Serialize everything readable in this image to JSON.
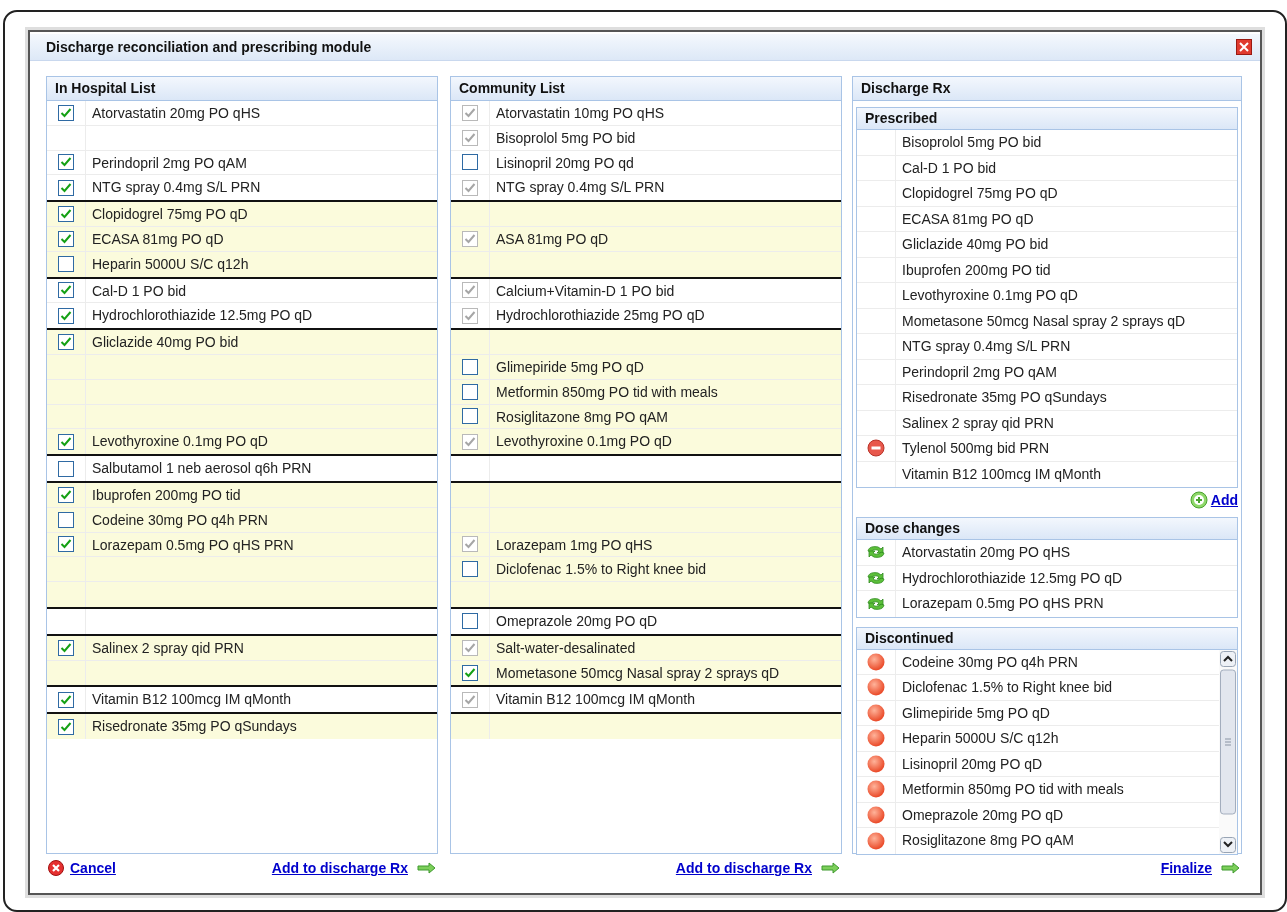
{
  "window": {
    "title": "Discharge reconciliation and prescribing module"
  },
  "in_hospital_list": {
    "title": "In Hospital List",
    "cancel_link": "Cancel",
    "footer_link": "Add to discharge Rx",
    "groups": [
      {
        "highlighted": false,
        "rows": [
          {
            "kind": "item",
            "label": "Atorvastatin 20mg PO qHS",
            "checked": true,
            "disabled": false
          },
          {
            "kind": "blank"
          },
          {
            "kind": "item",
            "label": "Perindopril 2mg PO qAM",
            "checked": true,
            "disabled": false
          },
          {
            "kind": "item",
            "label": "NTG spray 0.4mg S/L PRN",
            "checked": true,
            "disabled": false
          }
        ]
      },
      {
        "highlighted": true,
        "rows": [
          {
            "kind": "item",
            "label": "Clopidogrel 75mg PO qD",
            "checked": true,
            "disabled": false
          },
          {
            "kind": "item",
            "label": "ECASA 81mg PO qD",
            "checked": true,
            "disabled": false
          },
          {
            "kind": "item",
            "label": "Heparin 5000U S/C q12h",
            "checked": false,
            "disabled": false
          }
        ]
      },
      {
        "highlighted": false,
        "rows": [
          {
            "kind": "item",
            "label": "Cal-D 1 PO bid",
            "checked": true,
            "disabled": false
          },
          {
            "kind": "item",
            "label": "Hydrochlorothiazide 12.5mg PO qD",
            "checked": true,
            "disabled": false
          }
        ]
      },
      {
        "highlighted": true,
        "rows": [
          {
            "kind": "item",
            "label": "Gliclazide 40mg PO bid",
            "checked": true,
            "disabled": false
          },
          {
            "kind": "blank"
          },
          {
            "kind": "blank"
          },
          {
            "kind": "blank"
          },
          {
            "kind": "item",
            "label": "Levothyroxine 0.1mg PO qD",
            "checked": true,
            "disabled": false
          }
        ]
      },
      {
        "highlighted": false,
        "rows": [
          {
            "kind": "item",
            "label": "Salbutamol 1 neb aerosol q6h PRN",
            "checked": false,
            "disabled": false
          }
        ]
      },
      {
        "highlighted": true,
        "rows": [
          {
            "kind": "item",
            "label": "Ibuprofen 200mg PO tid",
            "checked": true,
            "disabled": false
          },
          {
            "kind": "item",
            "label": "Codeine 30mg PO q4h PRN",
            "checked": false,
            "disabled": false
          },
          {
            "kind": "item",
            "label": "Lorazepam 0.5mg PO qHS PRN",
            "checked": true,
            "disabled": false
          },
          {
            "kind": "blank"
          },
          {
            "kind": "blank"
          }
        ]
      },
      {
        "highlighted": false,
        "rows": [
          {
            "kind": "blank"
          }
        ]
      },
      {
        "highlighted": true,
        "rows": [
          {
            "kind": "item",
            "label": "Salinex 2 spray qid PRN",
            "checked": true,
            "disabled": false
          },
          {
            "kind": "blank"
          }
        ]
      },
      {
        "highlighted": false,
        "rows": [
          {
            "kind": "item",
            "label": "Vitamin B12 100mcg IM qMonth",
            "checked": true,
            "disabled": false
          }
        ]
      },
      {
        "highlighted": true,
        "rows": [
          {
            "kind": "item",
            "label": "Risedronate 35mg PO qSundays",
            "checked": true,
            "disabled": false
          }
        ]
      }
    ]
  },
  "community_list": {
    "title": "Community List",
    "footer_link": "Add to discharge Rx",
    "groups": [
      {
        "highlighted": false,
        "rows": [
          {
            "kind": "item",
            "label": "Atorvastatin 10mg PO qHS",
            "checked": true,
            "disabled": true
          },
          {
            "kind": "item",
            "label": "Bisoprolol 5mg PO bid",
            "checked": true,
            "disabled": true
          },
          {
            "kind": "item",
            "label": "Lisinopril 20mg PO qd",
            "checked": false,
            "disabled": false
          },
          {
            "kind": "item",
            "label": "NTG spray 0.4mg S/L PRN",
            "checked": true,
            "disabled": true
          }
        ]
      },
      {
        "highlighted": true,
        "rows": [
          {
            "kind": "blank"
          },
          {
            "kind": "item",
            "label": "ASA 81mg PO qD",
            "checked": true,
            "disabled": true
          },
          {
            "kind": "blank"
          }
        ]
      },
      {
        "highlighted": false,
        "rows": [
          {
            "kind": "item",
            "label": "Calcium+Vitamin-D 1 PO bid",
            "checked": true,
            "disabled": true
          },
          {
            "kind": "item",
            "label": "Hydrochlorothiazide 25mg PO qD",
            "checked": true,
            "disabled": true
          }
        ]
      },
      {
        "highlighted": true,
        "rows": [
          {
            "kind": "blank"
          },
          {
            "kind": "item",
            "label": "Glimepiride 5mg PO qD",
            "checked": false,
            "disabled": false
          },
          {
            "kind": "item",
            "label": "Metformin 850mg PO tid with meals",
            "checked": false,
            "disabled": false
          },
          {
            "kind": "item",
            "label": "Rosiglitazone 8mg PO qAM",
            "checked": false,
            "disabled": false
          },
          {
            "kind": "item",
            "label": "Levothyroxine 0.1mg PO qD",
            "checked": true,
            "disabled": true
          }
        ]
      },
      {
        "highlighted": false,
        "rows": [
          {
            "kind": "blank"
          }
        ]
      },
      {
        "highlighted": true,
        "rows": [
          {
            "kind": "blank"
          },
          {
            "kind": "blank"
          },
          {
            "kind": "item",
            "label": "Lorazepam 1mg PO qHS",
            "checked": true,
            "disabled": true
          },
          {
            "kind": "item",
            "label": "Diclofenac 1.5% to Right knee bid",
            "checked": false,
            "disabled": false
          },
          {
            "kind": "blank"
          }
        ]
      },
      {
        "highlighted": false,
        "rows": [
          {
            "kind": "item",
            "label": "Omeprazole 20mg PO qD",
            "checked": false,
            "disabled": false
          }
        ]
      },
      {
        "highlighted": true,
        "rows": [
          {
            "kind": "item",
            "label": "Salt-water-desalinated",
            "checked": true,
            "disabled": true
          },
          {
            "kind": "item",
            "label": "Mometasone 50mcg Nasal spray 2 sprays qD",
            "checked": true,
            "disabled": false
          }
        ]
      },
      {
        "highlighted": false,
        "rows": [
          {
            "kind": "item",
            "label": "Vitamin B12 100mcg IM qMonth",
            "checked": true,
            "disabled": true
          }
        ]
      },
      {
        "highlighted": true,
        "rows": [
          {
            "kind": "blank"
          }
        ]
      }
    ]
  },
  "discharge_rx": {
    "title": "Discharge Rx",
    "finalize_link": "Finalize",
    "prescribed": {
      "title": "Prescribed",
      "add_link": "Add",
      "items": [
        {
          "kind": "plain",
          "label": "Bisoprolol 5mg PO bid"
        },
        {
          "kind": "plain",
          "label": "Cal-D 1 PO bid"
        },
        {
          "kind": "plain",
          "label": "Clopidogrel 75mg PO qD"
        },
        {
          "kind": "plain",
          "label": "ECASA 81mg PO qD"
        },
        {
          "kind": "plain",
          "label": "Gliclazide 40mg PO bid"
        },
        {
          "kind": "plain",
          "label": "Ibuprofen 200mg PO tid"
        },
        {
          "kind": "plain",
          "label": "Levothyroxine 0.1mg PO qD"
        },
        {
          "kind": "plain",
          "label": "Mometasone 50mcg Nasal spray 2 sprays qD"
        },
        {
          "kind": "plain",
          "label": "NTG spray 0.4mg S/L PRN"
        },
        {
          "kind": "plain",
          "label": "Perindopril 2mg PO qAM"
        },
        {
          "kind": "plain",
          "label": "Risedronate 35mg PO qSundays"
        },
        {
          "kind": "plain",
          "label": "Salinex 2 spray qid PRN"
        },
        {
          "kind": "remove",
          "label": "Tylenol 500mg bid PRN"
        },
        {
          "kind": "plain",
          "label": "Vitamin B12 100mcg IM qMonth"
        }
      ]
    },
    "dose_changes": {
      "title": "Dose changes",
      "items": [
        {
          "kind": "dose_change",
          "label": "Atorvastatin 20mg PO qHS"
        },
        {
          "kind": "dose_change",
          "label": "Hydrochlorothiazide 12.5mg PO qD"
        },
        {
          "kind": "dose_change",
          "label": "Lorazepam 0.5mg PO qHS PRN"
        }
      ]
    },
    "discontinued": {
      "title": "Discontinued",
      "items": [
        {
          "kind": "discontinued",
          "label": "Codeine 30mg PO q4h PRN"
        },
        {
          "kind": "discontinued",
          "label": "Diclofenac 1.5% to Right knee bid"
        },
        {
          "kind": "discontinued",
          "label": "Glimepiride 5mg PO qD"
        },
        {
          "kind": "discontinued",
          "label": "Heparin 5000U S/C q12h"
        },
        {
          "kind": "discontinued",
          "label": "Lisinopril 20mg PO qD"
        },
        {
          "kind": "discontinued",
          "label": "Metformin 850mg PO tid with meals"
        },
        {
          "kind": "discontinued",
          "label": "Omeprazole 20mg PO qD"
        },
        {
          "kind": "discontinued",
          "label": "Rosiglitazone 8mg PO qAM"
        }
      ]
    }
  }
}
